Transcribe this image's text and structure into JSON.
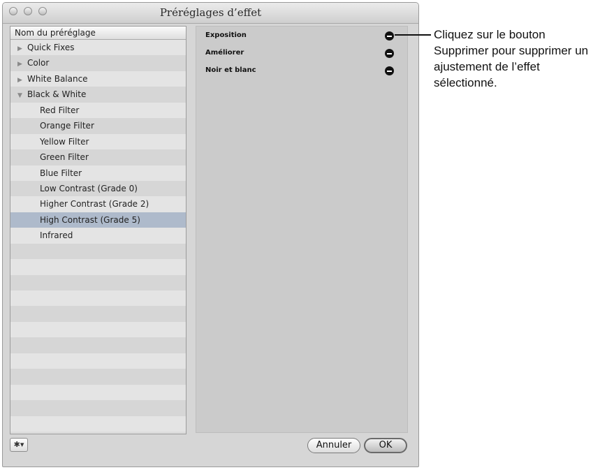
{
  "window": {
    "title": "Préréglages d’effet"
  },
  "preset_list": {
    "column_header": "Nom du préréglage",
    "items": [
      {
        "label": "Quick Fixes",
        "level": 0,
        "disclosure": "▶"
      },
      {
        "label": "Color",
        "level": 0,
        "disclosure": "▶"
      },
      {
        "label": "White Balance",
        "level": 0,
        "disclosure": "▶"
      },
      {
        "label": "Black & White",
        "level": 0,
        "disclosure": "▼"
      },
      {
        "label": "Red Filter",
        "level": 1
      },
      {
        "label": "Orange Filter",
        "level": 1
      },
      {
        "label": "Yellow Filter",
        "level": 1
      },
      {
        "label": "Green Filter",
        "level": 1
      },
      {
        "label": "Blue Filter",
        "level": 1
      },
      {
        "label": "Low Contrast (Grade 0)",
        "level": 1
      },
      {
        "label": "Higher Contrast (Grade 2)",
        "level": 1
      },
      {
        "label": "High Contrast (Grade 5)",
        "level": 1,
        "selected": true
      },
      {
        "label": "Infrared",
        "level": 1
      }
    ]
  },
  "adjustments": [
    {
      "label": "Exposition"
    },
    {
      "label": "Améliorer"
    },
    {
      "label": "Noir et blanc"
    }
  ],
  "buttons": {
    "gear_icon": "✱▾",
    "cancel": "Annuler",
    "ok": "OK"
  },
  "callout": {
    "text": "Cliquez sur le bouton Supprimer pour supprimer un ajustement de l’effet sélectionné."
  },
  "colors": {
    "selection": "#aebacb",
    "remove_button": "#111111"
  }
}
